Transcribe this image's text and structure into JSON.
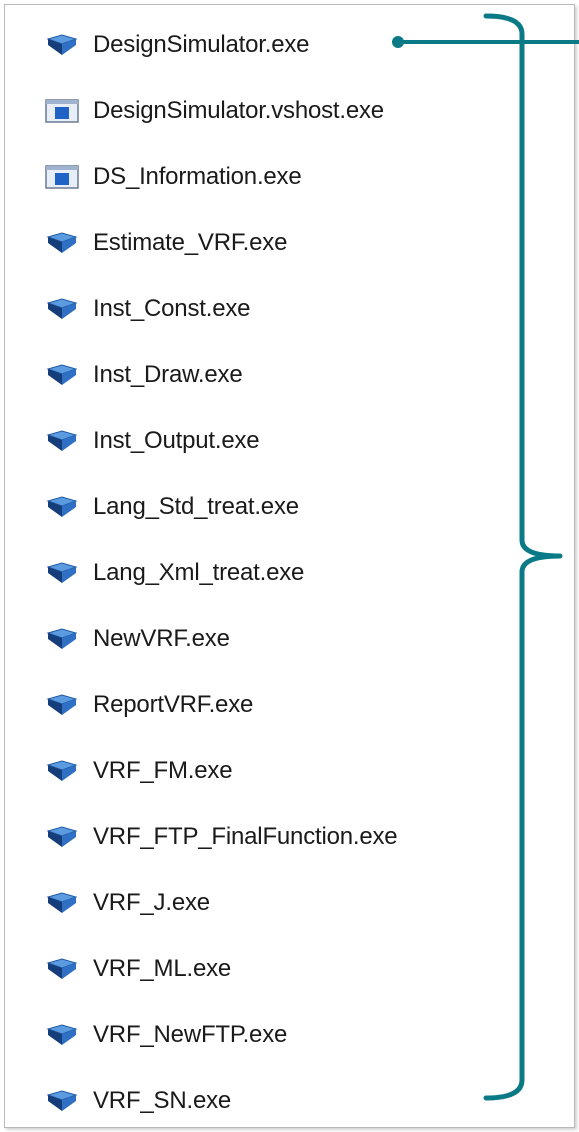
{
  "files": [
    {
      "name": "DesignSimulator.exe",
      "icon": "app-exe-icon"
    },
    {
      "name": "DesignSimulator.vshost.exe",
      "icon": "window-exe-icon"
    },
    {
      "name": "DS_Information.exe",
      "icon": "window-exe-icon"
    },
    {
      "name": "Estimate_VRF.exe",
      "icon": "app-exe-icon"
    },
    {
      "name": "Inst_Const.exe",
      "icon": "app-exe-icon"
    },
    {
      "name": "Inst_Draw.exe",
      "icon": "app-exe-icon"
    },
    {
      "name": "Inst_Output.exe",
      "icon": "app-exe-icon"
    },
    {
      "name": "Lang_Std_treat.exe",
      "icon": "app-exe-icon"
    },
    {
      "name": "Lang_Xml_treat.exe",
      "icon": "app-exe-icon"
    },
    {
      "name": "NewVRF.exe",
      "icon": "app-exe-icon"
    },
    {
      "name": "ReportVRF.exe",
      "icon": "app-exe-icon"
    },
    {
      "name": "VRF_FM.exe",
      "icon": "app-exe-icon"
    },
    {
      "name": "VRF_FTP_FinalFunction.exe",
      "icon": "app-exe-icon"
    },
    {
      "name": "VRF_J.exe",
      "icon": "app-exe-icon"
    },
    {
      "name": "VRF_ML.exe",
      "icon": "app-exe-icon"
    },
    {
      "name": "VRF_NewFTP.exe",
      "icon": "app-exe-icon"
    },
    {
      "name": "VRF_SN.exe",
      "icon": "app-exe-icon"
    }
  ],
  "colors": {
    "annotation": "#0a7a86",
    "text": "#1a1a1a",
    "icon_blue": "#2f6fc4",
    "icon_dark": "#153d7a"
  }
}
